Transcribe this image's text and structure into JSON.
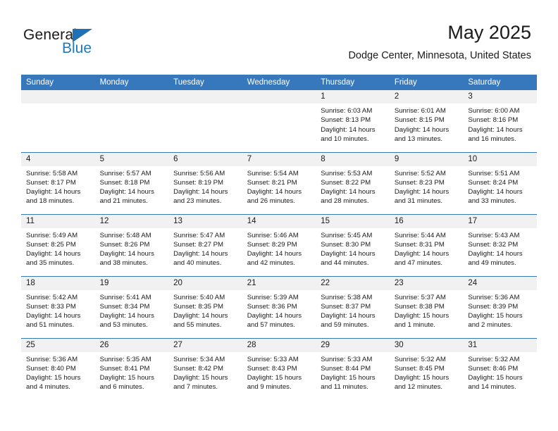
{
  "brand": {
    "name_line1": "General",
    "name_line2": "Blue",
    "triangle_icon": "triangle-icon",
    "accent_color": "#1f70b4"
  },
  "header": {
    "title": "May 2025",
    "subtitle": "Dodge Center, Minnesota, United States",
    "header_bg_color": "#3778bd",
    "band_bg_color": "#f1f1f1"
  },
  "weekdays": [
    "Sunday",
    "Monday",
    "Tuesday",
    "Wednesday",
    "Thursday",
    "Friday",
    "Saturday"
  ],
  "labels": {
    "sunrise_prefix": "Sunrise:",
    "sunset_prefix": "Sunset:",
    "daylight_prefix": "Daylight:"
  },
  "weeks": [
    [
      {
        "day": "",
        "sunrise": "",
        "sunset": "",
        "daylight_line1": "",
        "daylight_line2": ""
      },
      {
        "day": "",
        "sunrise": "",
        "sunset": "",
        "daylight_line1": "",
        "daylight_line2": ""
      },
      {
        "day": "",
        "sunrise": "",
        "sunset": "",
        "daylight_line1": "",
        "daylight_line2": ""
      },
      {
        "day": "",
        "sunrise": "",
        "sunset": "",
        "daylight_line1": "",
        "daylight_line2": ""
      },
      {
        "day": "1",
        "sunrise": "Sunrise: 6:03 AM",
        "sunset": "Sunset: 8:13 PM",
        "daylight_line1": "Daylight: 14 hours",
        "daylight_line2": "and 10 minutes."
      },
      {
        "day": "2",
        "sunrise": "Sunrise: 6:01 AM",
        "sunset": "Sunset: 8:15 PM",
        "daylight_line1": "Daylight: 14 hours",
        "daylight_line2": "and 13 minutes."
      },
      {
        "day": "3",
        "sunrise": "Sunrise: 6:00 AM",
        "sunset": "Sunset: 8:16 PM",
        "daylight_line1": "Daylight: 14 hours",
        "daylight_line2": "and 16 minutes."
      }
    ],
    [
      {
        "day": "4",
        "sunrise": "Sunrise: 5:58 AM",
        "sunset": "Sunset: 8:17 PM",
        "daylight_line1": "Daylight: 14 hours",
        "daylight_line2": "and 18 minutes."
      },
      {
        "day": "5",
        "sunrise": "Sunrise: 5:57 AM",
        "sunset": "Sunset: 8:18 PM",
        "daylight_line1": "Daylight: 14 hours",
        "daylight_line2": "and 21 minutes."
      },
      {
        "day": "6",
        "sunrise": "Sunrise: 5:56 AM",
        "sunset": "Sunset: 8:19 PM",
        "daylight_line1": "Daylight: 14 hours",
        "daylight_line2": "and 23 minutes."
      },
      {
        "day": "7",
        "sunrise": "Sunrise: 5:54 AM",
        "sunset": "Sunset: 8:21 PM",
        "daylight_line1": "Daylight: 14 hours",
        "daylight_line2": "and 26 minutes."
      },
      {
        "day": "8",
        "sunrise": "Sunrise: 5:53 AM",
        "sunset": "Sunset: 8:22 PM",
        "daylight_line1": "Daylight: 14 hours",
        "daylight_line2": "and 28 minutes."
      },
      {
        "day": "9",
        "sunrise": "Sunrise: 5:52 AM",
        "sunset": "Sunset: 8:23 PM",
        "daylight_line1": "Daylight: 14 hours",
        "daylight_line2": "and 31 minutes."
      },
      {
        "day": "10",
        "sunrise": "Sunrise: 5:51 AM",
        "sunset": "Sunset: 8:24 PM",
        "daylight_line1": "Daylight: 14 hours",
        "daylight_line2": "and 33 minutes."
      }
    ],
    [
      {
        "day": "11",
        "sunrise": "Sunrise: 5:49 AM",
        "sunset": "Sunset: 8:25 PM",
        "daylight_line1": "Daylight: 14 hours",
        "daylight_line2": "and 35 minutes."
      },
      {
        "day": "12",
        "sunrise": "Sunrise: 5:48 AM",
        "sunset": "Sunset: 8:26 PM",
        "daylight_line1": "Daylight: 14 hours",
        "daylight_line2": "and 38 minutes."
      },
      {
        "day": "13",
        "sunrise": "Sunrise: 5:47 AM",
        "sunset": "Sunset: 8:27 PM",
        "daylight_line1": "Daylight: 14 hours",
        "daylight_line2": "and 40 minutes."
      },
      {
        "day": "14",
        "sunrise": "Sunrise: 5:46 AM",
        "sunset": "Sunset: 8:29 PM",
        "daylight_line1": "Daylight: 14 hours",
        "daylight_line2": "and 42 minutes."
      },
      {
        "day": "15",
        "sunrise": "Sunrise: 5:45 AM",
        "sunset": "Sunset: 8:30 PM",
        "daylight_line1": "Daylight: 14 hours",
        "daylight_line2": "and 44 minutes."
      },
      {
        "day": "16",
        "sunrise": "Sunrise: 5:44 AM",
        "sunset": "Sunset: 8:31 PM",
        "daylight_line1": "Daylight: 14 hours",
        "daylight_line2": "and 47 minutes."
      },
      {
        "day": "17",
        "sunrise": "Sunrise: 5:43 AM",
        "sunset": "Sunset: 8:32 PM",
        "daylight_line1": "Daylight: 14 hours",
        "daylight_line2": "and 49 minutes."
      }
    ],
    [
      {
        "day": "18",
        "sunrise": "Sunrise: 5:42 AM",
        "sunset": "Sunset: 8:33 PM",
        "daylight_line1": "Daylight: 14 hours",
        "daylight_line2": "and 51 minutes."
      },
      {
        "day": "19",
        "sunrise": "Sunrise: 5:41 AM",
        "sunset": "Sunset: 8:34 PM",
        "daylight_line1": "Daylight: 14 hours",
        "daylight_line2": "and 53 minutes."
      },
      {
        "day": "20",
        "sunrise": "Sunrise: 5:40 AM",
        "sunset": "Sunset: 8:35 PM",
        "daylight_line1": "Daylight: 14 hours",
        "daylight_line2": "and 55 minutes."
      },
      {
        "day": "21",
        "sunrise": "Sunrise: 5:39 AM",
        "sunset": "Sunset: 8:36 PM",
        "daylight_line1": "Daylight: 14 hours",
        "daylight_line2": "and 57 minutes."
      },
      {
        "day": "22",
        "sunrise": "Sunrise: 5:38 AM",
        "sunset": "Sunset: 8:37 PM",
        "daylight_line1": "Daylight: 14 hours",
        "daylight_line2": "and 59 minutes."
      },
      {
        "day": "23",
        "sunrise": "Sunrise: 5:37 AM",
        "sunset": "Sunset: 8:38 PM",
        "daylight_line1": "Daylight: 15 hours",
        "daylight_line2": "and 1 minute."
      },
      {
        "day": "24",
        "sunrise": "Sunrise: 5:36 AM",
        "sunset": "Sunset: 8:39 PM",
        "daylight_line1": "Daylight: 15 hours",
        "daylight_line2": "and 2 minutes."
      }
    ],
    [
      {
        "day": "25",
        "sunrise": "Sunrise: 5:36 AM",
        "sunset": "Sunset: 8:40 PM",
        "daylight_line1": "Daylight: 15 hours",
        "daylight_line2": "and 4 minutes."
      },
      {
        "day": "26",
        "sunrise": "Sunrise: 5:35 AM",
        "sunset": "Sunset: 8:41 PM",
        "daylight_line1": "Daylight: 15 hours",
        "daylight_line2": "and 6 minutes."
      },
      {
        "day": "27",
        "sunrise": "Sunrise: 5:34 AM",
        "sunset": "Sunset: 8:42 PM",
        "daylight_line1": "Daylight: 15 hours",
        "daylight_line2": "and 7 minutes."
      },
      {
        "day": "28",
        "sunrise": "Sunrise: 5:33 AM",
        "sunset": "Sunset: 8:43 PM",
        "daylight_line1": "Daylight: 15 hours",
        "daylight_line2": "and 9 minutes."
      },
      {
        "day": "29",
        "sunrise": "Sunrise: 5:33 AM",
        "sunset": "Sunset: 8:44 PM",
        "daylight_line1": "Daylight: 15 hours",
        "daylight_line2": "and 11 minutes."
      },
      {
        "day": "30",
        "sunrise": "Sunrise: 5:32 AM",
        "sunset": "Sunset: 8:45 PM",
        "daylight_line1": "Daylight: 15 hours",
        "daylight_line2": "and 12 minutes."
      },
      {
        "day": "31",
        "sunrise": "Sunrise: 5:32 AM",
        "sunset": "Sunset: 8:46 PM",
        "daylight_line1": "Daylight: 15 hours",
        "daylight_line2": "and 14 minutes."
      }
    ]
  ]
}
